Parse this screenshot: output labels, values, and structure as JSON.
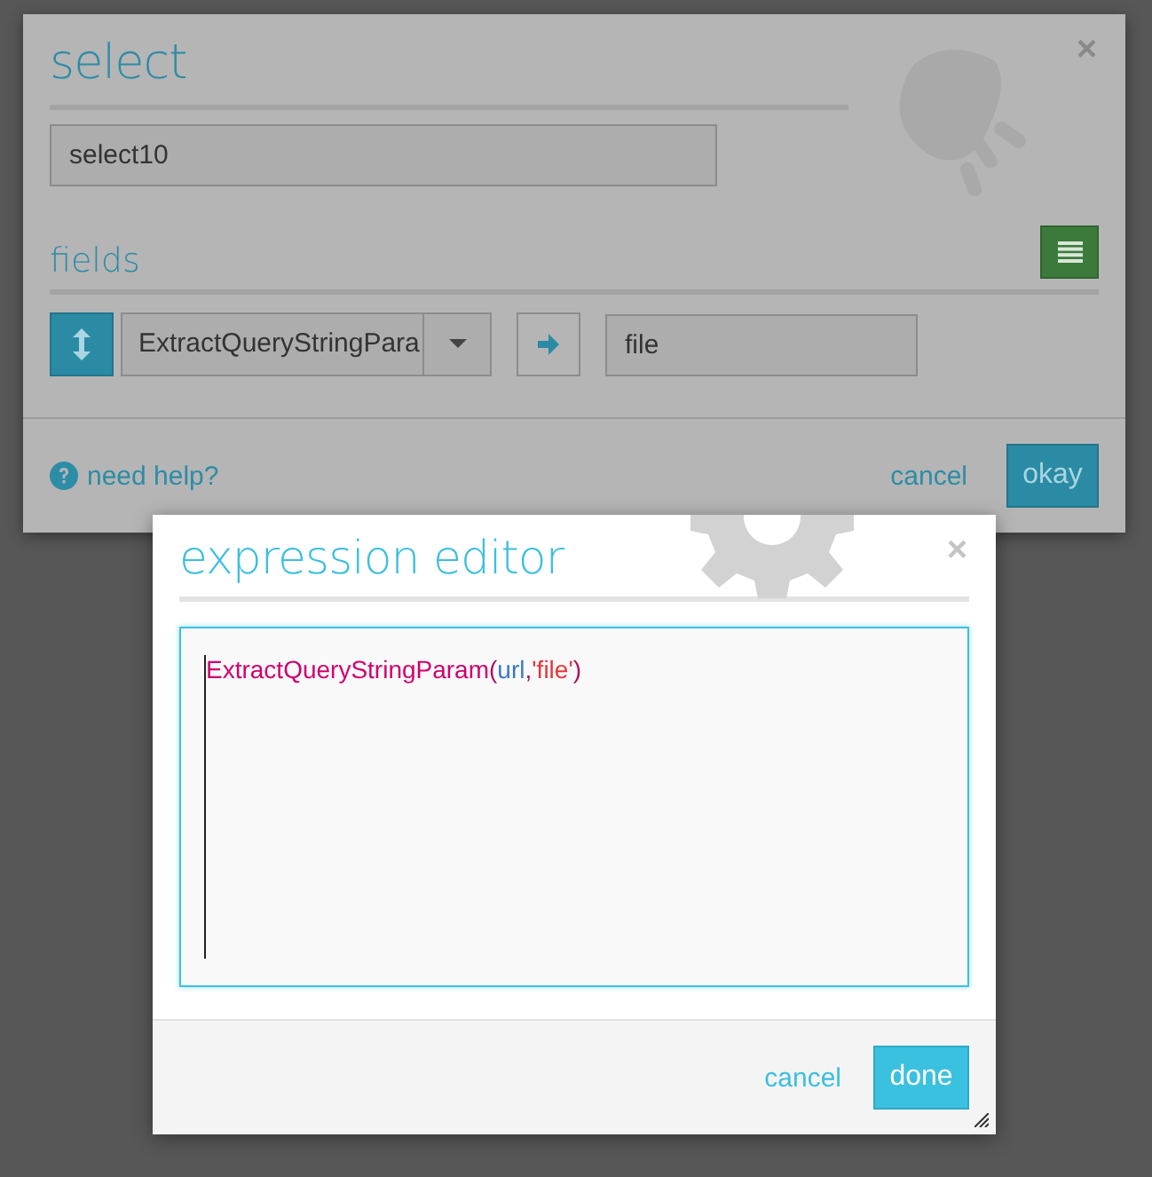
{
  "select_dialog": {
    "title": "select",
    "close": "×",
    "name_value": "select10",
    "fields_label": "fields",
    "field_row": {
      "expression": "ExtractQueryStringPara",
      "target": "file"
    },
    "help_link": "need help?",
    "cancel": "cancel",
    "okay": "okay"
  },
  "expression_editor": {
    "title": "expression editor",
    "close": "×",
    "code": [
      {
        "kind": "function",
        "text": "ExtractQueryStringParam"
      },
      {
        "kind": "punct",
        "text": "("
      },
      {
        "kind": "variable",
        "text": "url"
      },
      {
        "kind": "punct",
        "text": ","
      },
      {
        "kind": "string",
        "text": "'file'"
      },
      {
        "kind": "punct",
        "text": ")"
      }
    ],
    "cancel": "cancel",
    "done": "done"
  }
}
